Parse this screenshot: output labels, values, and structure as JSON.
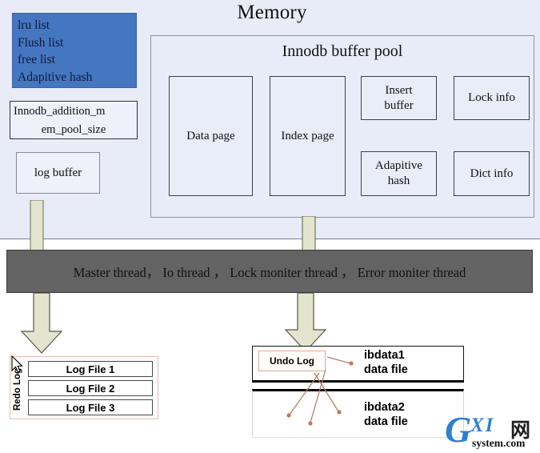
{
  "diagram": {
    "title": "Memory",
    "memory": {
      "lru_box": {
        "lines": [
          "lru list",
          "Flush list",
          "free list",
          "Adapitive hash"
        ],
        "fill_color": "#4576c0",
        "text_color": "#101a3c"
      },
      "mem_pool_box": {
        "line1": "Innodb_addition_m",
        "line2": "em_pool_size"
      },
      "log_buffer_box": {
        "label": "log buffer"
      },
      "buffer_pool": {
        "title": "Innodb buffer pool",
        "boxes": [
          {
            "label": "Data page"
          },
          {
            "label": "Index page"
          },
          {
            "label": "Insert\nbuffer"
          },
          {
            "label": "Lock info"
          },
          {
            "label": "Adapitive\nhash"
          },
          {
            "label": "Dict info"
          }
        ]
      }
    },
    "thread_bar": {
      "label": "Master thread，  Io thread  ，  Lock moniter thread  ，  Error moniter thread",
      "fill_color": "#636363"
    },
    "redo_log": {
      "side_label": "Redo Log",
      "files": [
        "Log File 1",
        "Log File 2",
        "Log File 3"
      ]
    },
    "ibdata": {
      "undo_log_label": "Undo Log",
      "file1": "ibdata1\ndata file",
      "file2": "ibdata2\ndata file"
    },
    "watermark": {
      "g": "G",
      "xi": "XI",
      "cn": "网",
      "sub": "system.com",
      "brand_color": "#2f7fd0"
    }
  }
}
